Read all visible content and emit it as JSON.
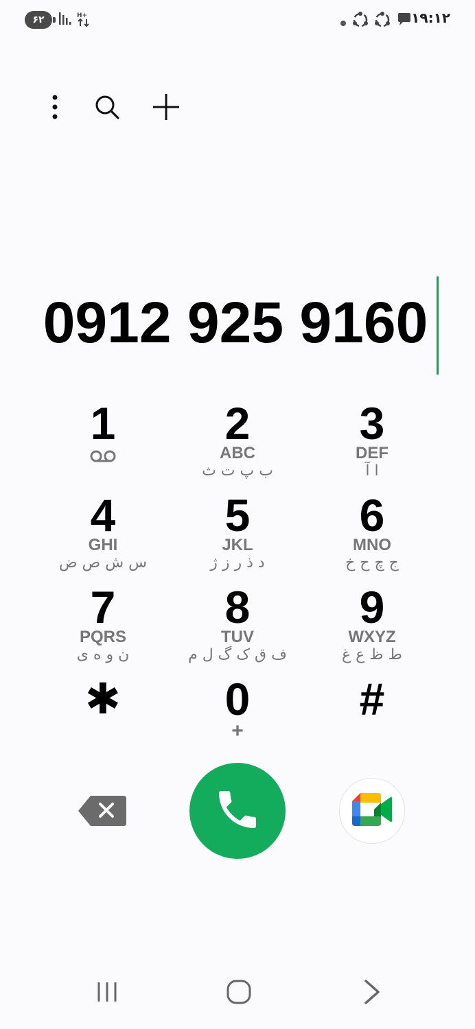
{
  "status_bar": {
    "battery": "۶۲",
    "time": "۱۹:۱۲",
    "icons": [
      "signal-icon",
      "data-transfer-icon",
      "dot-icon",
      "sync-icon",
      "sync-icon",
      "message-icon"
    ]
  },
  "toolbar": {
    "icons": [
      "more-options-icon",
      "search-icon",
      "add-contact-icon"
    ]
  },
  "dialer": {
    "number": "0912 925 9160"
  },
  "keypad": [
    {
      "digit": "1",
      "letters": "",
      "persian": "",
      "sub_icon": "voicemail-icon"
    },
    {
      "digit": "2",
      "letters": "ABC",
      "persian": "ب پ ت ث"
    },
    {
      "digit": "3",
      "letters": "DEF",
      "persian": "ا آ"
    },
    {
      "digit": "4",
      "letters": "GHI",
      "persian": "س ش ص ض"
    },
    {
      "digit": "5",
      "letters": "JKL",
      "persian": "د ذ ر ز ژ"
    },
    {
      "digit": "6",
      "letters": "MNO",
      "persian": "ج چ ح خ"
    },
    {
      "digit": "7",
      "letters": "PQRS",
      "persian": "ن و ه ی"
    },
    {
      "digit": "8",
      "letters": "TUV",
      "persian": "ف ق ک گ ل م"
    },
    {
      "digit": "9",
      "letters": "WXYZ",
      "persian": "ط ظ ع غ"
    },
    {
      "digit": "✱",
      "letters": "",
      "persian": ""
    },
    {
      "digit": "0",
      "letters": "+",
      "persian": ""
    },
    {
      "digit": "#",
      "letters": "",
      "persian": ""
    }
  ],
  "actions": {
    "backspace_icon": "backspace-icon",
    "call_icon": "phone-icon",
    "meet_icon": "google-meet-icon",
    "call_color": "#13ac5c"
  },
  "nav_bar": {
    "icons": [
      "recent-apps-icon",
      "home-icon",
      "back-icon"
    ]
  }
}
